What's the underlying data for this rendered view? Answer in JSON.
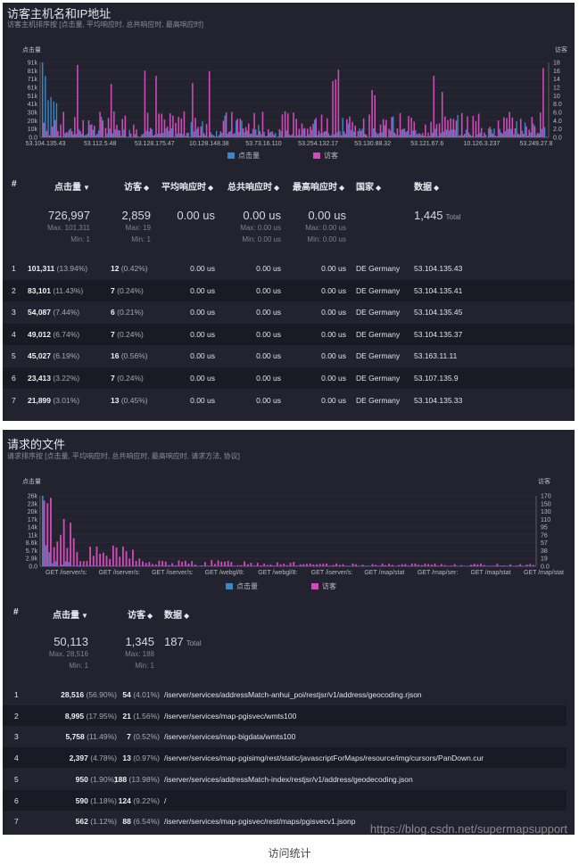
{
  "hosts": {
    "title": "访客主机名和IP地址",
    "subtitle": "访客主机排序按 [点击量, 平均响应时, 总共响应时, 最高响应时]",
    "chart_data": {
      "type": "bar",
      "left_axis_label": "点击量",
      "right_axis_label": "访客",
      "left_ticks": [
        "91k",
        "81k",
        "71k",
        "61k",
        "51k",
        "41k",
        "30k",
        "20k",
        "10k",
        "0.0"
      ],
      "right_ticks": [
        "18",
        "16",
        "14",
        "12",
        "10",
        "8.0",
        "6.0",
        "4.0",
        "2.0",
        "0.0"
      ],
      "left_max": 101311,
      "right_max": 19,
      "categories": [
        "53.104.135.43",
        "53.112.5.48",
        "53.128.175.47",
        "10.128.148.38",
        "53.73.16.110",
        "53.254.132.17",
        "53.130.88.32",
        "53.121.67.6",
        "10.126.3.237",
        "53.249.27.8"
      ],
      "series": [
        {
          "name": "点击量",
          "color": "#3a86c8"
        },
        {
          "name": "访客",
          "color": "#d04ab8"
        }
      ]
    },
    "legend": [
      "点击量",
      "访客"
    ],
    "columns": [
      "#",
      "点击量",
      "访客",
      "平均响应时",
      "总共响应时",
      "最高响应时",
      "国家",
      "数据"
    ],
    "summary": {
      "hits": "726,997",
      "hits_max": "Max. 101,311",
      "hits_min": "Min: 1",
      "visitors": "2,859",
      "visitors_max": "Max: 19",
      "visitors_min": "Min: 1",
      "avg": "0.00 us",
      "total": "0.00 us",
      "total_max": "Max: 0.00 us",
      "total_min": "Min: 0.00 us",
      "maxr": "0.00 us",
      "maxr_max": "Max: 0.00 us",
      "maxr_min": "Min: 0.00 us",
      "data": "1,445",
      "data_total": "Total"
    },
    "rows": [
      {
        "n": "1",
        "hits": "101,311",
        "hits_pct": "(13.94%)",
        "vis": "12",
        "vis_pct": "(0.42%)",
        "avg": "0.00 us",
        "total": "0.00 us",
        "maxr": "0.00 us",
        "country": "DE Germany",
        "data": "53.104.135.43"
      },
      {
        "n": "2",
        "hits": "83,101",
        "hits_pct": "(11.43%)",
        "vis": "7",
        "vis_pct": "(0.24%)",
        "avg": "0.00 us",
        "total": "0.00 us",
        "maxr": "0.00 us",
        "country": "DE Germany",
        "data": "53.104.135.41"
      },
      {
        "n": "3",
        "hits": "54,087",
        "hits_pct": "(7.44%)",
        "vis": "6",
        "vis_pct": "(0.21%)",
        "avg": "0.00 us",
        "total": "0.00 us",
        "maxr": "0.00 us",
        "country": "DE Germany",
        "data": "53.104.135.45"
      },
      {
        "n": "4",
        "hits": "49,012",
        "hits_pct": "(6.74%)",
        "vis": "7",
        "vis_pct": "(0.24%)",
        "avg": "0.00 us",
        "total": "0.00 us",
        "maxr": "0.00 us",
        "country": "DE Germany",
        "data": "53.104.135.37"
      },
      {
        "n": "5",
        "hits": "45,027",
        "hits_pct": "(6.19%)",
        "vis": "16",
        "vis_pct": "(0.56%)",
        "avg": "0.00 us",
        "total": "0.00 us",
        "maxr": "0.00 us",
        "country": "DE Germany",
        "data": "53.163.11.11"
      },
      {
        "n": "6",
        "hits": "23,413",
        "hits_pct": "(3.22%)",
        "vis": "7",
        "vis_pct": "(0.24%)",
        "avg": "0.00 us",
        "total": "0.00 us",
        "maxr": "0.00 us",
        "country": "DE Germany",
        "data": "53.107.135.9"
      },
      {
        "n": "7",
        "hits": "21,899",
        "hits_pct": "(3.01%)",
        "vis": "13",
        "vis_pct": "(0.45%)",
        "avg": "0.00 us",
        "total": "0.00 us",
        "maxr": "0.00 us",
        "country": "DE Germany",
        "data": "53.104.135.33"
      }
    ]
  },
  "files": {
    "title": "请求的文件",
    "subtitle": "请求排序按 [点击量, 平均响应时, 总共响应时, 最高响应时, 请求方法, 协议]",
    "chart_data": {
      "type": "bar",
      "left_axis_label": "点击量",
      "right_axis_label": "访客",
      "left_ticks": [
        "26k",
        "23k",
        "20k",
        "17k",
        "14k",
        "11k",
        "8.6k",
        "5.7k",
        "2.9k",
        "0.0"
      ],
      "right_ticks": [
        "170",
        "150",
        "130",
        "110",
        "95",
        "76",
        "57",
        "38",
        "19",
        "0.0"
      ],
      "left_max": 28516,
      "right_max": 188,
      "categories": [
        "GET /iserver/s:",
        "GET /iserver/s:",
        "GET /iserver/s:",
        "GET /webgl/8:",
        "GET /webgl/8:",
        "GET /iserver/s:",
        "GET /map/stat",
        "GET /map/ser:",
        "GET /map/stat",
        "GET /map/stat"
      ],
      "series": [
        {
          "name": "点击量",
          "color": "#3a86c8"
        },
        {
          "name": "访客",
          "color": "#d04ab8"
        }
      ]
    },
    "legend": [
      "点击量",
      "访客"
    ],
    "columns": [
      "#",
      "点击量",
      "访客",
      "数据"
    ],
    "summary": {
      "hits": "50,113",
      "hits_max": "Max. 28,516",
      "hits_min": "Min: 1",
      "visitors": "1,345",
      "visitors_max": "Max: 188",
      "visitors_min": "Min: 1",
      "data": "187",
      "data_total": "Total"
    },
    "rows": [
      {
        "n": "1",
        "hits": "28,516",
        "hits_pct": "(56.90%)",
        "vis": "54",
        "vis_pct": "(4.01%)",
        "data": "/iserver/services/addressMatch-anhui_poi/restjsr/v1/address/geocoding.rjson"
      },
      {
        "n": "2",
        "hits": "8,995",
        "hits_pct": "(17.95%)",
        "vis": "21",
        "vis_pct": "(1.56%)",
        "data": "/iserver/services/map-pgisvec/wmts100"
      },
      {
        "n": "3",
        "hits": "5,758",
        "hits_pct": "(11.49%)",
        "vis": "7",
        "vis_pct": "(0.52%)",
        "data": "/iserver/services/map-bigdata/wmts100"
      },
      {
        "n": "4",
        "hits": "2,397",
        "hits_pct": "(4.78%)",
        "vis": "13",
        "vis_pct": "(0.97%)",
        "data": "/iserver/services/map-pgisimg/rest/static/javascriptForMaps/resource/img/cursors/PanDown.cur"
      },
      {
        "n": "5",
        "hits": "950",
        "hits_pct": "(1.90%)",
        "vis": "188",
        "vis_pct": "(13.98%)",
        "data": "/iserver/services/addressMatch-index/restjsr/v1/address/geodecoding.json"
      },
      {
        "n": "6",
        "hits": "590",
        "hits_pct": "(1.18%)",
        "vis": "124",
        "vis_pct": "(9.22%)",
        "data": "/"
      },
      {
        "n": "7",
        "hits": "562",
        "hits_pct": "(1.12%)",
        "vis": "88",
        "vis_pct": "(6.54%)",
        "data": "/iserver/services/map-pgisvec/rest/maps/pgisvecv1.jsonp"
      }
    ]
  },
  "watermark": "https://blog.csdn.net/supermapsupport",
  "caption": "访问统计"
}
